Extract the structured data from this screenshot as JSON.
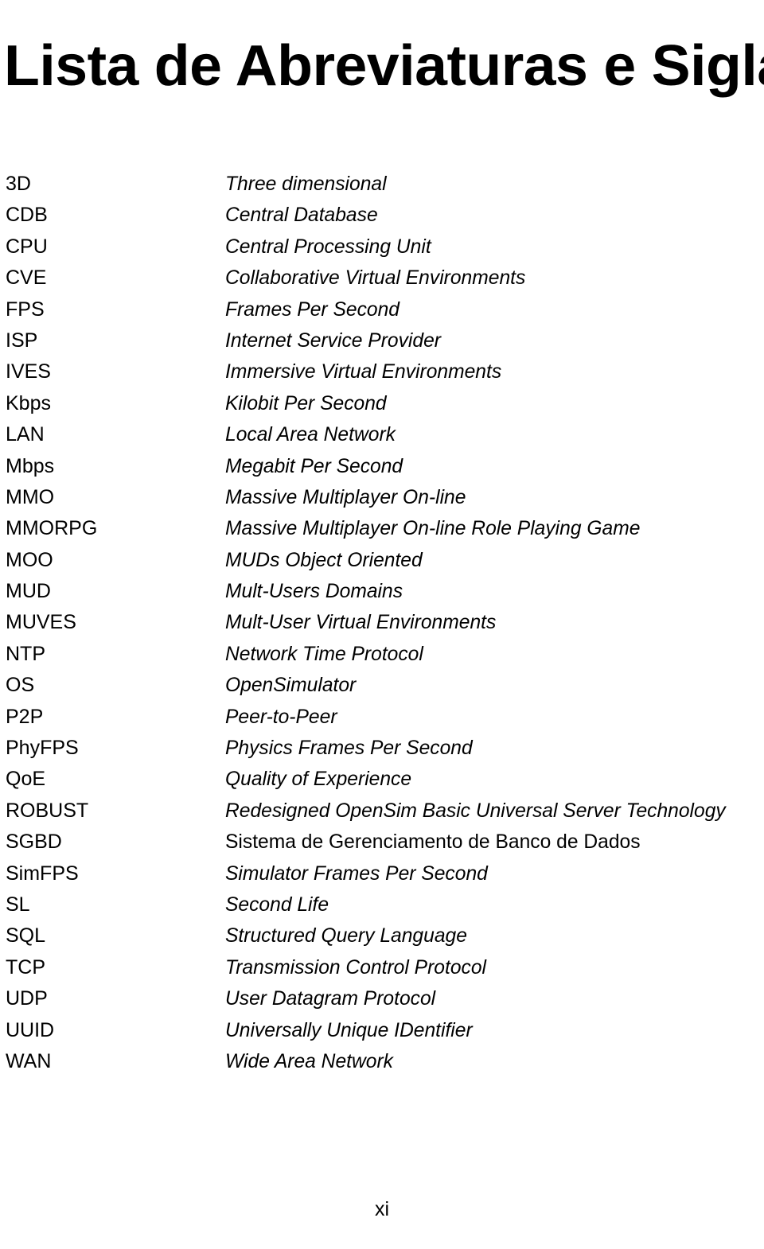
{
  "document": {
    "title": "Lista de Abreviaturas e Siglas",
    "page_number": "xi"
  },
  "abbreviations": [
    {
      "term": "3D",
      "definition": "Three dimensional",
      "italic": true
    },
    {
      "term": "CDB",
      "definition": "Central Database",
      "italic": true
    },
    {
      "term": "CPU",
      "definition": "Central Processing Unit",
      "italic": true
    },
    {
      "term": "CVE",
      "definition": "Collaborative Virtual Environments",
      "italic": true
    },
    {
      "term": "FPS",
      "definition": "Frames Per Second",
      "italic": true
    },
    {
      "term": "ISP",
      "definition": "Internet Service Provider",
      "italic": true
    },
    {
      "term": "IVES",
      "definition": "Immersive Virtual Environments",
      "italic": true
    },
    {
      "term": "Kbps",
      "definition": "Kilobit Per Second",
      "italic": true
    },
    {
      "term": "LAN",
      "definition": "Local Area Network",
      "italic": true
    },
    {
      "term": "Mbps",
      "definition": "Megabit Per Second",
      "italic": true
    },
    {
      "term": "MMO",
      "definition": "Massive Multiplayer On-line",
      "italic": true
    },
    {
      "term": "MMORPG",
      "definition": "Massive Multiplayer On-line Role Playing Game",
      "italic": true
    },
    {
      "term": "MOO",
      "definition": "MUDs Object Oriented",
      "italic": true
    },
    {
      "term": "MUD",
      "definition": "Mult-Users Domains",
      "italic": true
    },
    {
      "term": "MUVES",
      "definition": "Mult-User Virtual Environments",
      "italic": true
    },
    {
      "term": "NTP",
      "definition": "Network Time Protocol",
      "italic": true
    },
    {
      "term": "OS",
      "definition": "OpenSimulator",
      "italic": true
    },
    {
      "term": "P2P",
      "definition": "Peer-to-Peer",
      "italic": true
    },
    {
      "term": "PhyFPS",
      "definition": "Physics Frames Per Second",
      "italic": true
    },
    {
      "term": "QoE",
      "definition": "Quality of Experience",
      "italic": true
    },
    {
      "term": "ROBUST",
      "definition": "Redesigned OpenSim Basic Universal Server Technology",
      "italic": true
    },
    {
      "term": "SGBD",
      "definition": "Sistema de Gerenciamento de Banco de Dados",
      "italic": false
    },
    {
      "term": "SimFPS",
      "definition": "Simulator Frames Per Second",
      "italic": true
    },
    {
      "term": "SL",
      "definition": "Second Life",
      "italic": true
    },
    {
      "term": "SQL",
      "definition": "Structured Query Language",
      "italic": true
    },
    {
      "term": "TCP",
      "definition": "Transmission Control Protocol",
      "italic": true
    },
    {
      "term": "UDP",
      "definition": "User Datagram Protocol",
      "italic": true
    },
    {
      "term": "UUID",
      "definition": "Universally Unique IDentifier",
      "italic": true
    },
    {
      "term": "WAN",
      "definition": "Wide Area Network",
      "italic": true
    }
  ]
}
